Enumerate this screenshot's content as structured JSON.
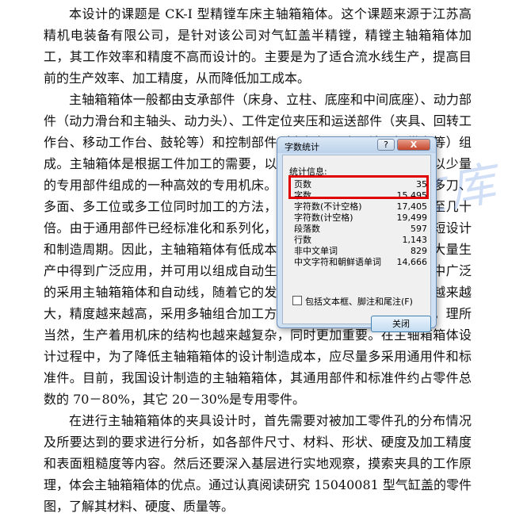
{
  "document": {
    "paragraphs": [
      "本设计的课题是 CK-I 型精镗车床主轴箱箱体。这个课题来源于江苏高精机电装备有限公司，是针对该公司对气缸盖半精镗，精镗主轴箱箱体加工，其工作效率和精度不高而设计的。主要是为了适合流水线生产，提高目前的生产效率、加工精度，从而降低加工成本。",
      "主轴箱箱体一般都由支承部件（床身、立柱、底座和中间底座）、动力部件（动力滑台和主轴头、动力头）、工件定位夹压和运送部件（夹具、回转工作台、移动工作台、鼓轮等）和控制部件（电气柜、液压站、操纵台等）组成。主轴箱体是根据工件加工的需要，以大量的通用部件为基础，配以少量的专用部件组成的一种高效的专用机床。主轴箱箱体一般采用多轴、多刀、多面、多工位或多工位同时加工的方法，生产效率比通用机床高几倍至几十倍。由于通用部件已经标准化和系列化，可根据需要灵活配置，能缩短设计和制造周期。因此，主轴箱箱体有低成本和高效率的优点，在大批、大量生产中得到广泛应用，并可用以组成自动生产线。多年来机械产品加工中广泛的采用主轴箱箱体和自动线，随着它的发展，很多企业的产品的产量越来越大，精度越来越高，采用多轴组合加工方法已经不能很好的满足要求。理所当然，生产着用机床的结构也越来越复杂，同时更加重要。在主轴箱箱体设计过程中，为了降低主轴箱箱体的设计制造成本，应尽量多采用通用件和标准件。目前，我国设计制造的主轴箱箱体，其通用部件和标准件约占零件总数的 70－80%，其它 20－30%是专用零件。",
      "在进行主轴箱箱体的夹具设计时，首先需要对被加工零件孔的分布情况及所要达到的要求进行分析，如各部件尺寸、材料、形状、硬度及加工精度和表面粗糙度等内容。然后还要深入基层进行实地观察，摸索夹具的工作原理，体会主轴箱箱体的优点。通过认真阅读研究 15040081 型气缸盖的零件图，了解其材料、硬度、质量等。"
    ]
  },
  "watermark": {
    "text": "人人文库"
  },
  "dialog": {
    "title": "字数统计",
    "help_label": "?",
    "close_label": "X",
    "section_label": "统计信息:",
    "rows": [
      {
        "label": "页数",
        "value": "35"
      },
      {
        "label": "字数",
        "value": "15,495"
      },
      {
        "label": "字符数(不计空格)",
        "value": "17,405"
      },
      {
        "label": "字符数(计空格)",
        "value": "19,499"
      },
      {
        "label": "段落数",
        "value": "597"
      },
      {
        "label": "行数",
        "value": "1,143"
      },
      {
        "label": "非中文单词",
        "value": "829"
      },
      {
        "label": "中文字符和朝鲜语单词",
        "value": "14,666"
      }
    ],
    "checkbox_label": "包括文本框、脚注和尾注(F)",
    "ok_label": "关闭"
  }
}
